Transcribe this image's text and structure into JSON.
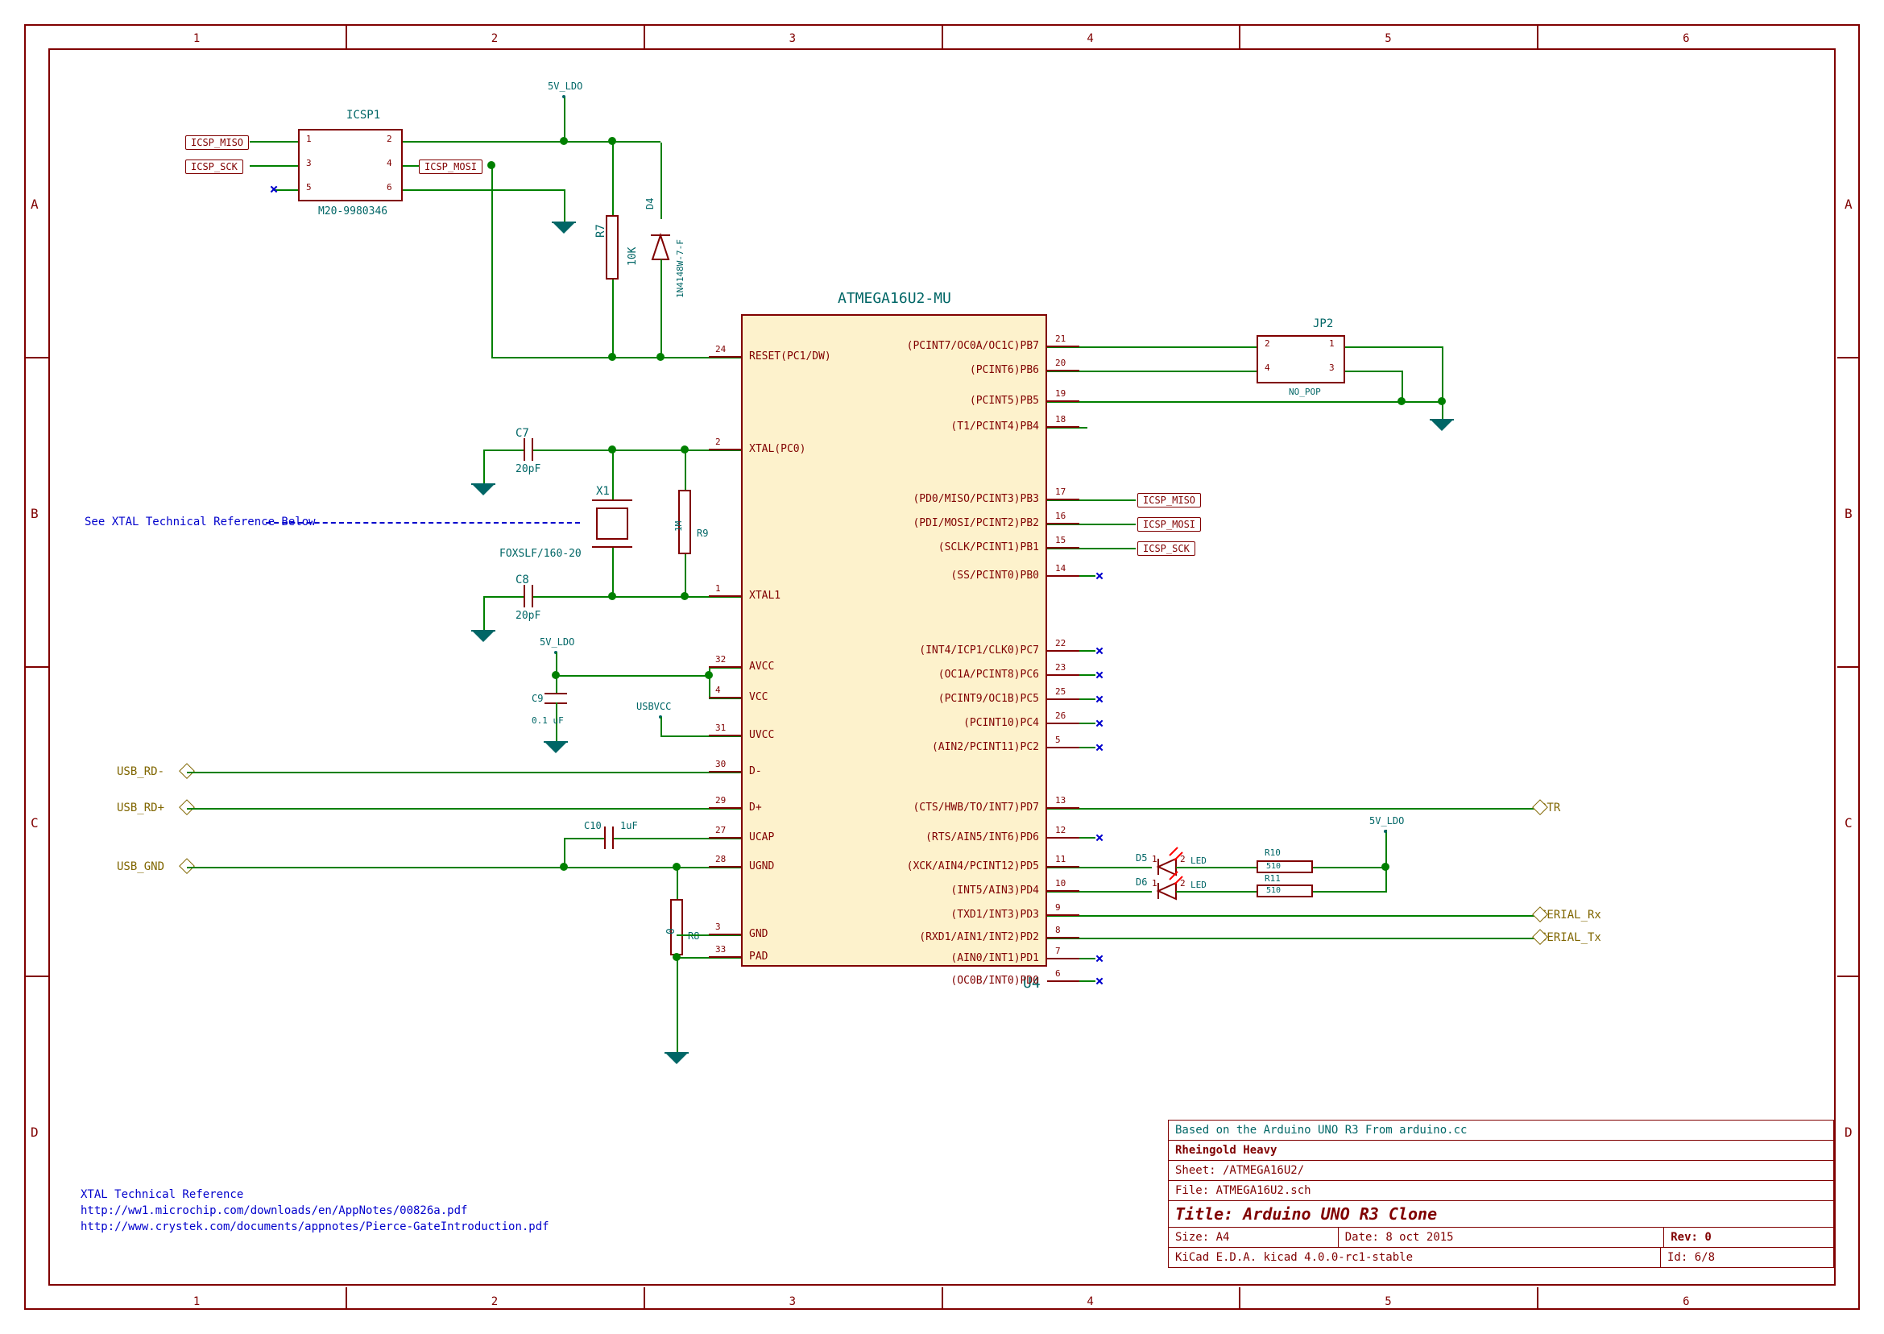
{
  "title_block": {
    "based_on": "Based on the Arduino UNO R3 From arduino.cc",
    "company": "Rheingold Heavy",
    "sheet": "Sheet: /ATMEGA16U2/",
    "file": "File: ATMEGA16U2.sch",
    "title": "Title: Arduino UNO R3 Clone",
    "size": "Size: A4",
    "date": "Date: 8 oct 2015",
    "rev": "Rev: 0",
    "tool": "KiCad E.D.A.  kicad 4.0.0-rc1-stable",
    "id": "Id: 6/8"
  },
  "ruler": {
    "top": [
      "1",
      "2",
      "3",
      "4",
      "5",
      "6"
    ],
    "side": [
      "A",
      "B",
      "C",
      "D"
    ]
  },
  "chip": {
    "ref": "U4",
    "value": "ATMEGA16U2-MU",
    "left_pins": [
      {
        "num": "24",
        "name": "RESET(PC1/DW)"
      },
      {
        "num": "2",
        "name": "XTAL(PC0)"
      },
      {
        "num": "1",
        "name": "XTAL1"
      },
      {
        "num": "32",
        "name": "AVCC"
      },
      {
        "num": "4",
        "name": "VCC"
      },
      {
        "num": "31",
        "name": "UVCC"
      },
      {
        "num": "30",
        "name": "D-"
      },
      {
        "num": "29",
        "name": "D+"
      },
      {
        "num": "27",
        "name": "UCAP"
      },
      {
        "num": "28",
        "name": "UGND"
      },
      {
        "num": "3",
        "name": "GND"
      },
      {
        "num": "33",
        "name": "PAD"
      }
    ],
    "right_pins": [
      {
        "num": "21",
        "name": "(PCINT7/OC0A/OC1C)PB7"
      },
      {
        "num": "20",
        "name": "(PCINT6)PB6"
      },
      {
        "num": "19",
        "name": "(PCINT5)PB5"
      },
      {
        "num": "18",
        "name": "(T1/PCINT4)PB4"
      },
      {
        "num": "17",
        "name": "(PD0/MISO/PCINT3)PB3"
      },
      {
        "num": "16",
        "name": "(PDI/MOSI/PCINT2)PB2"
      },
      {
        "num": "15",
        "name": "(SCLK/PCINT1)PB1"
      },
      {
        "num": "14",
        "name": "(SS/PCINT0)PB0"
      },
      {
        "num": "22",
        "name": "(INT4/ICP1/CLK0)PC7"
      },
      {
        "num": "23",
        "name": "(OC1A/PCINT8)PC6"
      },
      {
        "num": "25",
        "name": "(PCINT9/OC1B)PC5"
      },
      {
        "num": "26",
        "name": "(PCINT10)PC4"
      },
      {
        "num": "5",
        "name": "(AIN2/PCINT11)PC2"
      },
      {
        "num": "13",
        "name": "(CTS/HWB/TO/INT7)PD7"
      },
      {
        "num": "12",
        "name": "(RTS/AIN5/INT6)PD6"
      },
      {
        "num": "11",
        "name": "(XCK/AIN4/PCINT12)PD5"
      },
      {
        "num": "10",
        "name": "(INT5/AIN3)PD4"
      },
      {
        "num": "9",
        "name": "(TXD1/INT3)PD3"
      },
      {
        "num": "8",
        "name": "(RXD1/AIN1/INT2)PD2"
      },
      {
        "num": "7",
        "name": "(AIN0/INT1)PD1"
      },
      {
        "num": "6",
        "name": "(OC0B/INT0)PD0"
      }
    ]
  },
  "icsp": {
    "ref": "ICSP1",
    "val": "M20-9980346",
    "pins": [
      "1",
      "2",
      "3",
      "4",
      "5",
      "6"
    ]
  },
  "jp2": {
    "ref": "JP2",
    "val": "NO_POP",
    "pins": [
      "1",
      "2",
      "3",
      "4"
    ]
  },
  "refs": {
    "R7": "10K",
    "R8": "0",
    "R9": "1M",
    "R10": "510",
    "R11": "510",
    "C7": "20pF",
    "C8": "20pF",
    "C9": "0.1 uF",
    "C10": "1uF",
    "D4": "1N4148W-7-F",
    "D5": "LED",
    "D6": "LED",
    "X1": "FOXSLF/160-20"
  },
  "net_tags": {
    "icsp_miso": "ICSP_MISO",
    "icsp_mosi": "ICSP_MOSI",
    "icsp_sck": "ICSP_SCK"
  },
  "hier_labels": {
    "usb_rd_minus": "USB_RD-",
    "usb_rd_plus": "USB_RD+",
    "usb_gnd": "USB_GND",
    "dtr": "DTR",
    "serial_rx": "SERIAL_Rx",
    "serial_tx": "SERIAL_Tx"
  },
  "power": {
    "p5v": "5V_LDO",
    "usbvcc": "USBVCC"
  },
  "notes": {
    "xtal_ref": "See XTAL Technical Reference Below",
    "xtal_title": "XTAL Technical Reference",
    "xtal_url1": "http://ww1.microchip.com/downloads/en/AppNotes/00826a.pdf",
    "xtal_url2": "http://www.crystek.com/documents/appnotes/Pierce-GateIntroduction.pdf"
  }
}
